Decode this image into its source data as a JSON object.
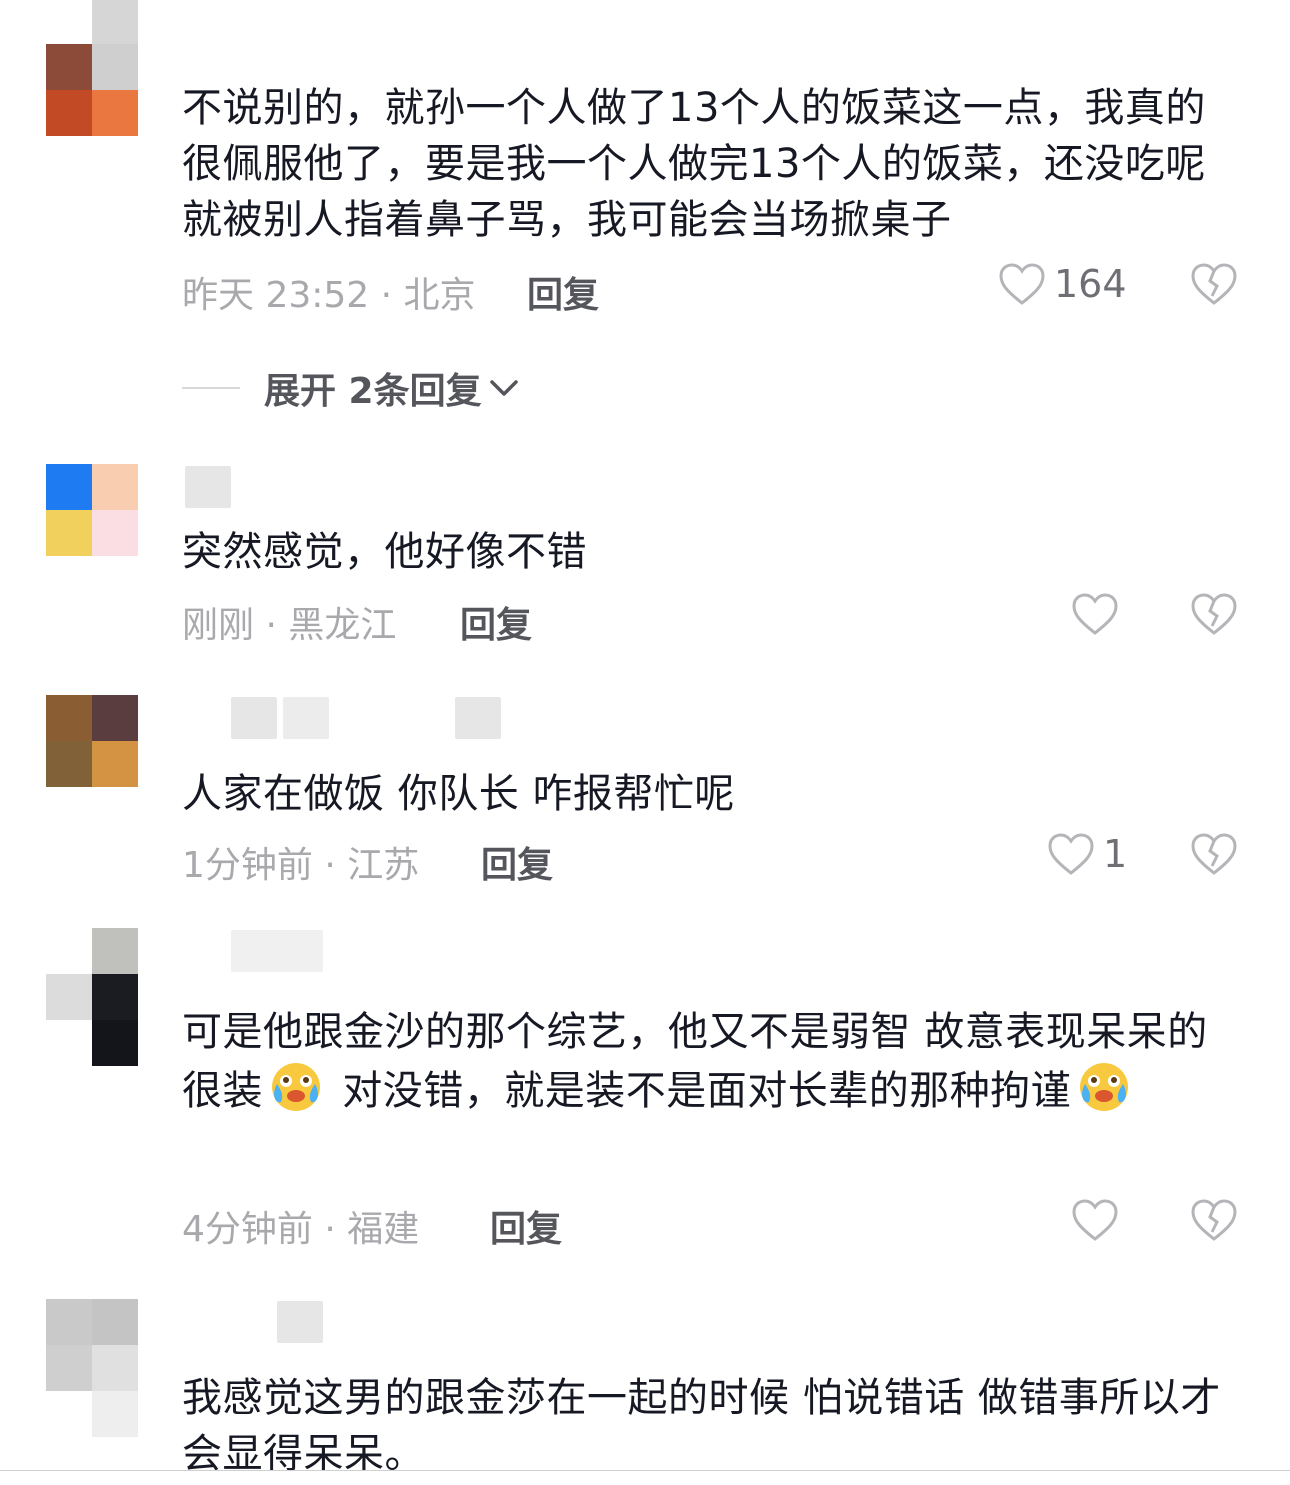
{
  "comments": [
    {
      "text": "不说别的，就孙一个人做了13个人的饭菜这一点，我真的很佩服他了，要是我一个人做完13个人的饭菜，还没吃呢就被别人指着鼻子骂，我可能会当场掀桌子",
      "meta": "昨天 23:52 · 北京",
      "reply_label": "回复",
      "likes": "164"
    },
    {
      "text": "突然感觉，他好像不错",
      "meta": "刚刚 · 黑龙江",
      "reply_label": "回复",
      "likes": ""
    },
    {
      "text": "人家在做饭 你队长  咋报帮忙呢",
      "meta": "1分钟前 · 江苏",
      "reply_label": "回复",
      "likes": "1"
    },
    {
      "text_part1": "可是他跟金沙的那个综艺，他又不是弱智 故意表现呆呆的 很装",
      "text_part2": " 对没错，就是装不是面对长辈的那种拘谨",
      "emoji": "crying-laughing-emoji",
      "meta": "4分钟前 · 福建",
      "reply_label": "回复",
      "likes": ""
    },
    {
      "text": "我感觉这男的跟金莎在一起的时候 怕说错话 做错事所以才会显得呆呆。"
    }
  ],
  "expand_replies": {
    "label": "展开 2条回复"
  },
  "colors": {
    "text": "#161823",
    "meta": "#a9a9ad",
    "reply": "#55565c",
    "icon": "#b5b5b9"
  },
  "icons": {
    "like": "heart-outline-icon",
    "dislike": "broken-heart-icon",
    "expand": "chevron-down-icon"
  }
}
